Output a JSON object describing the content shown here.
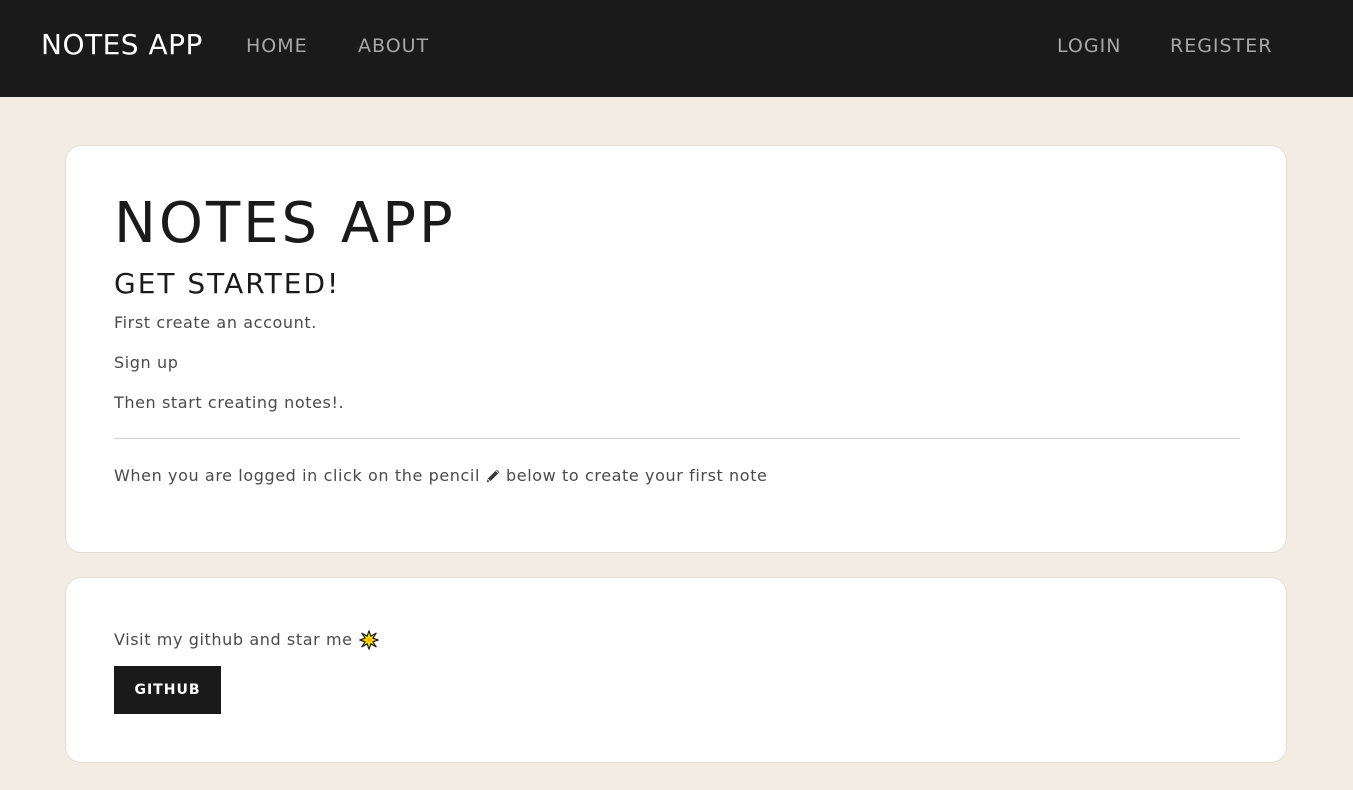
{
  "nav": {
    "brand": "NOTES APP",
    "home": "HOME",
    "about": "ABOUT",
    "login": "LOGIN",
    "register": "REGISTER"
  },
  "main_card": {
    "title": "NOTES APP",
    "subtitle": "GET STARTED!",
    "line_1": "First create an account.",
    "line_2": "Sign up",
    "line_3": "Then start creating notes!.",
    "pencil_prefix": "When you are logged in click on the pencil",
    "pencil_suffix": "below to create your first note",
    "pencil_icon": "pencil-icon"
  },
  "github_card": {
    "text": "Visit my github and star me",
    "star_icon": "sparkle-icon",
    "button_label": "GITHUB"
  },
  "colors": {
    "navbar_bg": "#1a1a1a",
    "page_bg": "#f3ece2",
    "card_bg": "#ffffff",
    "button_bg": "#1a1a1a",
    "nav_link": "#a8a8a8"
  }
}
